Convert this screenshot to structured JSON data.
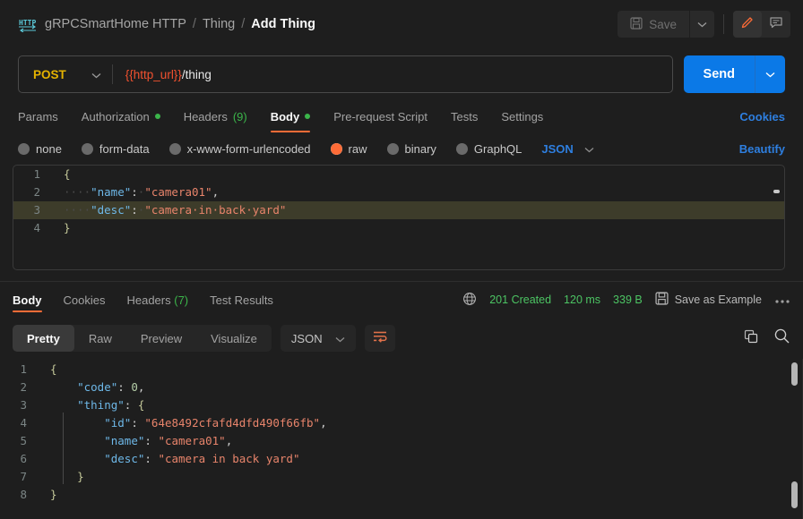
{
  "header": {
    "protocol_icon": "http-icon",
    "breadcrumb": [
      {
        "label": "gRPCSmartHome HTTP",
        "active": false
      },
      {
        "label": "Thing",
        "active": false
      },
      {
        "label": "Add Thing",
        "active": true
      }
    ],
    "separator": "/",
    "save_label": "Save",
    "save_caret": "⌄",
    "edit_icon": "pencil-icon",
    "comment_icon": "comment-icon"
  },
  "urlbar": {
    "method": "POST",
    "method_caret": "⌄",
    "url_variable": "{{http_url}}",
    "url_path": "/thing",
    "send_label": "Send",
    "send_caret": "⌄"
  },
  "request_tabs": {
    "items": [
      {
        "label": "Params",
        "active": false,
        "dot": false,
        "count": ""
      },
      {
        "label": "Authorization",
        "active": false,
        "dot": true,
        "count": ""
      },
      {
        "label": "Headers",
        "active": false,
        "dot": false,
        "count": "(9)"
      },
      {
        "label": "Body",
        "active": true,
        "dot": true,
        "count": ""
      },
      {
        "label": "Pre-request Script",
        "active": false,
        "dot": false,
        "count": ""
      },
      {
        "label": "Tests",
        "active": false,
        "dot": false,
        "count": ""
      },
      {
        "label": "Settings",
        "active": false,
        "dot": false,
        "count": ""
      }
    ],
    "cookies_label": "Cookies"
  },
  "body_type": {
    "options": [
      {
        "label": "none",
        "selected": false
      },
      {
        "label": "form-data",
        "selected": false
      },
      {
        "label": "x-www-form-urlencoded",
        "selected": false
      },
      {
        "label": "raw",
        "selected": true
      },
      {
        "label": "binary",
        "selected": false
      },
      {
        "label": "GraphQL",
        "selected": false
      }
    ],
    "format": "JSON",
    "format_caret": "⌄",
    "beautify_label": "Beautify"
  },
  "request_body": {
    "lines": [
      {
        "no": "1",
        "highlight": false,
        "tokens": [
          {
            "t": "{",
            "c": "br"
          }
        ]
      },
      {
        "no": "2",
        "highlight": false,
        "tokens": [
          {
            "t": "····",
            "c": "ws"
          },
          {
            "t": "\"name\"",
            "c": "k"
          },
          {
            "t": ":",
            "c": "p"
          },
          {
            "t": "·",
            "c": "ws"
          },
          {
            "t": "\"camera01\"",
            "c": "s"
          },
          {
            "t": ",",
            "c": "p"
          }
        ]
      },
      {
        "no": "3",
        "highlight": true,
        "tokens": [
          {
            "t": "····",
            "c": "ws"
          },
          {
            "t": "\"desc\"",
            "c": "k"
          },
          {
            "t": ":",
            "c": "p"
          },
          {
            "t": "·",
            "c": "ws"
          },
          {
            "t": "\"camera·in·back·yard\"",
            "c": "s"
          }
        ]
      },
      {
        "no": "4",
        "highlight": false,
        "tokens": [
          {
            "t": "}",
            "c": "br"
          }
        ]
      }
    ]
  },
  "response_tabs": {
    "items": [
      {
        "label": "Body",
        "active": true,
        "count": ""
      },
      {
        "label": "Cookies",
        "active": false,
        "count": ""
      },
      {
        "label": "Headers",
        "active": false,
        "count": "(7)"
      },
      {
        "label": "Test Results",
        "active": false,
        "count": ""
      }
    ],
    "globe_icon": "globe-icon",
    "status": "201 Created",
    "time": "120 ms",
    "size": "339 B",
    "save_icon": "floppy-disk-icon",
    "save_example_label": "Save as Example",
    "more_icon": "more-horizontal-icon"
  },
  "response_toolbar": {
    "views": [
      {
        "label": "Pretty",
        "active": true
      },
      {
        "label": "Raw",
        "active": false
      },
      {
        "label": "Preview",
        "active": false
      },
      {
        "label": "Visualize",
        "active": false
      }
    ],
    "format": "JSON",
    "format_caret": "⌄",
    "wrap_icon": "word-wrap-icon",
    "copy_icon": "copy-icon",
    "search_icon": "search-icon"
  },
  "response_body": {
    "lines": [
      {
        "no": "1",
        "tokens": [
          {
            "t": "{",
            "c": "br"
          }
        ]
      },
      {
        "no": "2",
        "tokens": [
          {
            "t": "    ",
            "c": "ws"
          },
          {
            "t": "\"code\"",
            "c": "k"
          },
          {
            "t": ": ",
            "c": "p"
          },
          {
            "t": "0",
            "c": "n"
          },
          {
            "t": ",",
            "c": "p"
          }
        ]
      },
      {
        "no": "3",
        "tokens": [
          {
            "t": "    ",
            "c": "ws"
          },
          {
            "t": "\"thing\"",
            "c": "k"
          },
          {
            "t": ": ",
            "c": "p"
          },
          {
            "t": "{",
            "c": "br"
          }
        ]
      },
      {
        "no": "4",
        "tokens": [
          {
            "t": "        ",
            "c": "ws"
          },
          {
            "t": "\"id\"",
            "c": "k"
          },
          {
            "t": ": ",
            "c": "p"
          },
          {
            "t": "\"64e8492cfafd4dfd490f66fb\"",
            "c": "s"
          },
          {
            "t": ",",
            "c": "p"
          }
        ]
      },
      {
        "no": "5",
        "tokens": [
          {
            "t": "        ",
            "c": "ws"
          },
          {
            "t": "\"name\"",
            "c": "k"
          },
          {
            "t": ": ",
            "c": "p"
          },
          {
            "t": "\"camera01\"",
            "c": "s"
          },
          {
            "t": ",",
            "c": "p"
          }
        ]
      },
      {
        "no": "6",
        "tokens": [
          {
            "t": "        ",
            "c": "ws"
          },
          {
            "t": "\"desc\"",
            "c": "k"
          },
          {
            "t": ": ",
            "c": "p"
          },
          {
            "t": "\"camera in back yard\"",
            "c": "s"
          }
        ]
      },
      {
        "no": "7",
        "tokens": [
          {
            "t": "    ",
            "c": "ws"
          },
          {
            "t": "}",
            "c": "br"
          }
        ]
      },
      {
        "no": "8",
        "tokens": [
          {
            "t": "}",
            "c": "br"
          }
        ]
      }
    ]
  },
  "colors": {
    "background": "#1e1e1e",
    "accent_orange": "#ff6c37",
    "send_blue": "#0b79e7",
    "link_blue": "#2e7fe0",
    "status_green": "#4cc463",
    "method_yellow": "#e4b200",
    "json_key": "#6eb8e8",
    "json_string": "#e8846b"
  }
}
